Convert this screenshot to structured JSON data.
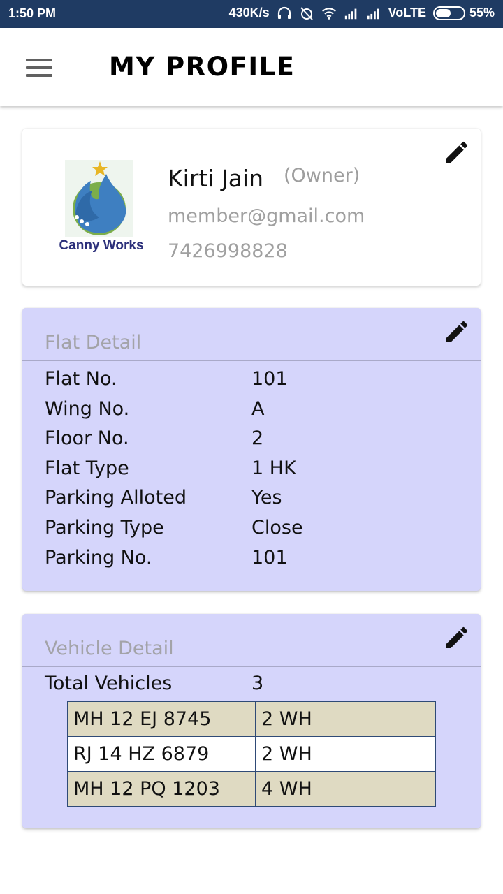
{
  "status_bar": {
    "time": "1:50 PM",
    "speed": "430K/s",
    "network": "VoLTE",
    "battery_percent": "55%",
    "battery_level": 0.55
  },
  "header": {
    "title": "MY PROFILE",
    "menu_icon": "hamburger-icon"
  },
  "profile": {
    "logo_text": "Canny Works",
    "name": "Kirti Jain",
    "role": "(Owner)",
    "email": "member@gmail.com",
    "phone": "7426998828",
    "edit_icon": "pencil-icon"
  },
  "flat_detail": {
    "title": "Flat Detail",
    "rows": [
      {
        "label": "Flat No.",
        "value": "101"
      },
      {
        "label": "Wing No.",
        "value": "A"
      },
      {
        "label": "Floor No.",
        "value": "2"
      },
      {
        "label": "Flat Type",
        "value": "1 HK"
      },
      {
        "label": "Parking Alloted",
        "value": "Yes"
      },
      {
        "label": "Parking Type",
        "value": "Close"
      },
      {
        "label": "Parking No.",
        "value": "101"
      }
    ]
  },
  "vehicle_detail": {
    "title": "Vehicle Detail",
    "total_label": "Total Vehicles",
    "total_value": "3",
    "vehicles": [
      {
        "number": "MH 12 EJ 8745",
        "type": "2 WH"
      },
      {
        "number": "RJ 14 HZ 6879",
        "type": "2 WH"
      },
      {
        "number": "MH 12 PQ 1203",
        "type": "4 WH"
      }
    ]
  },
  "colors": {
    "status_bar": "#1f3b63",
    "card_background": "#d5d5fb",
    "table_alt_row": "#dfdac2",
    "table_border": "#2f4a76"
  }
}
